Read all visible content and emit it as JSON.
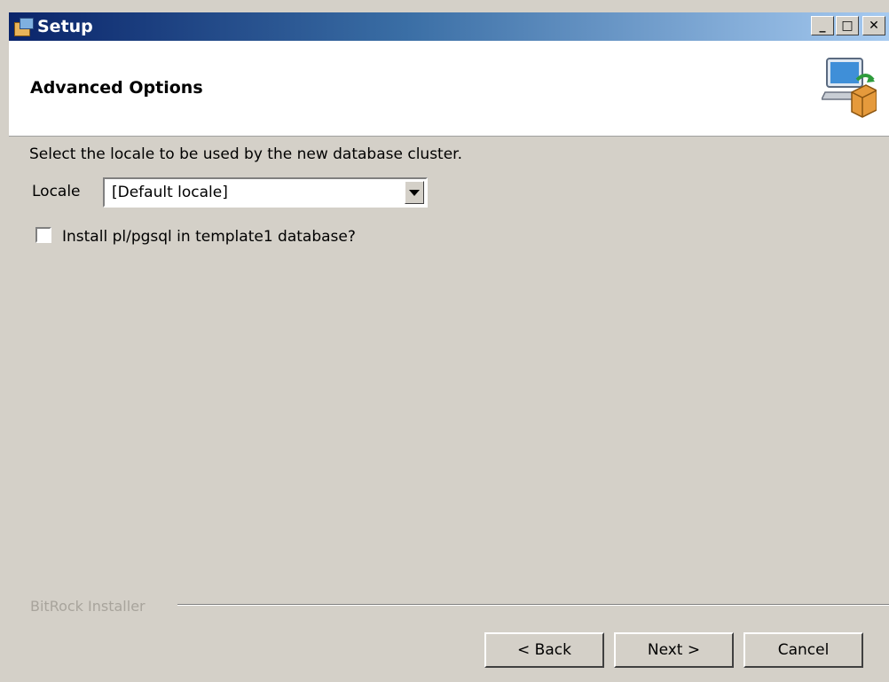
{
  "window": {
    "title": "Setup",
    "app_icon": "setup-icon",
    "controls": {
      "minimize": "_",
      "maximize": "□",
      "close": "✕"
    }
  },
  "header": {
    "title": "Advanced Options",
    "icon": "computer-package-icon"
  },
  "content": {
    "description": "Select the locale to be used by the new database cluster.",
    "locale_label": "Locale",
    "locale_value": "[Default locale]",
    "checkbox_label": "Install pl/pgsql in template1 database?",
    "checkbox_checked": false
  },
  "footer": {
    "brand": "BitRock Installer",
    "back_label": "< Back",
    "next_label": "Next >",
    "cancel_label": "Cancel"
  },
  "colors": {
    "title_bar_start": "#0a246a",
    "title_bar_end": "#a6caf0",
    "dialog_bg": "#d4d0c8",
    "header_bg": "#ffffff"
  }
}
